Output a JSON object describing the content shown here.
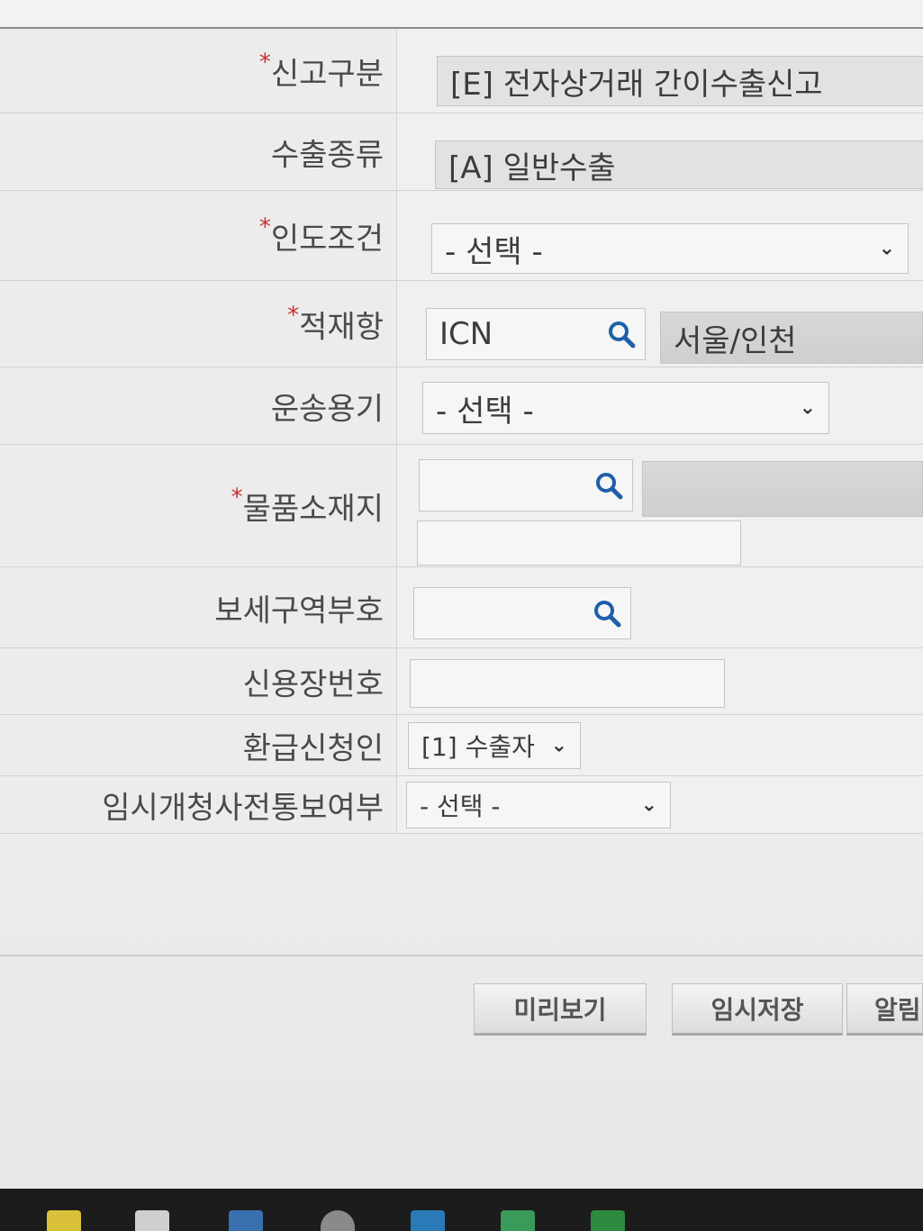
{
  "form": {
    "rows": [
      {
        "label": "신고구분",
        "required": true,
        "value": "[E] 전자상거래 간이수출신고"
      },
      {
        "label": "수출종류",
        "required": false,
        "value": "[A] 일반수출"
      },
      {
        "label": "인도조건",
        "required": true,
        "value": "- 선택 -"
      },
      {
        "label": "적재항",
        "required": true,
        "code": "ICN",
        "name": "서울/인천"
      },
      {
        "label": "운송용기",
        "required": false,
        "value": "- 선택 -"
      },
      {
        "label": "물품소재지",
        "required": true,
        "code": "",
        "name": "",
        "detail": ""
      },
      {
        "label": "보세구역부호",
        "required": false,
        "code": ""
      },
      {
        "label": "신용장번호",
        "required": false,
        "value": ""
      },
      {
        "label": "환급신청인",
        "required": false,
        "value": "[1] 수출자"
      },
      {
        "label": "임시개청사전통보여부",
        "required": false,
        "value": "- 선택 -"
      }
    ],
    "required_mark": "*"
  },
  "buttons": {
    "preview": "미리보기",
    "temp_save": "임시저장",
    "third_partial": "알림"
  },
  "colors": {
    "required": "#c8302a",
    "search_icon": "#1f5fa8"
  },
  "icons": {
    "search": "magnifier",
    "dropdown": "chevron-down"
  }
}
